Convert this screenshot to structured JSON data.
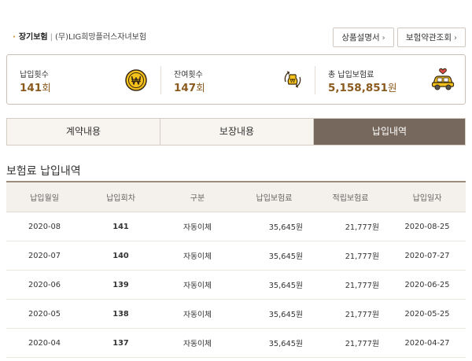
{
  "product": {
    "category": "장기보험",
    "separator": "|",
    "name": "(무)LIG희망플러스자녀보험"
  },
  "top_buttons": {
    "description": "상품설명서",
    "terms": "보험약관조회",
    "arrow": "›"
  },
  "summary": {
    "paid_count": {
      "label": "납입횟수",
      "value": "141",
      "unit": "회",
      "icon": "won-coin-icon"
    },
    "remaining_count": {
      "label": "잔여횟수",
      "value": "147",
      "unit": "회",
      "icon": "money-bag-cycle-icon"
    },
    "total_premium": {
      "label": "총 납입보험료",
      "value": "5,158,851",
      "unit": "원",
      "icon": "car-with-heart-icon"
    }
  },
  "tabs": [
    "계약내용",
    "보장내용",
    "납입내역"
  ],
  "active_tab": 2,
  "section_title": "보험료 납입내역",
  "table": {
    "headers": [
      "납입월일",
      "납입회차",
      "구분",
      "납입보험료",
      "적립보험료",
      "납입일자"
    ],
    "rows": [
      [
        "2020-08",
        "141",
        "자동이체",
        "35,645원",
        "21,777원",
        "2020-08-25"
      ],
      [
        "2020-07",
        "140",
        "자동이체",
        "35,645원",
        "21,777원",
        "2020-07-27"
      ],
      [
        "2020-06",
        "139",
        "자동이체",
        "35,645원",
        "21,777원",
        "2020-06-25"
      ],
      [
        "2020-05",
        "138",
        "자동이체",
        "35,645원",
        "21,777원",
        "2020-05-25"
      ],
      [
        "2020-04",
        "137",
        "자동이체",
        "35,645원",
        "21,777원",
        "2020-04-27"
      ]
    ]
  },
  "colors": {
    "accent_brown": "#76685c",
    "value_text": "#8a5a1e",
    "coin_yellow": "#f5c21b"
  }
}
